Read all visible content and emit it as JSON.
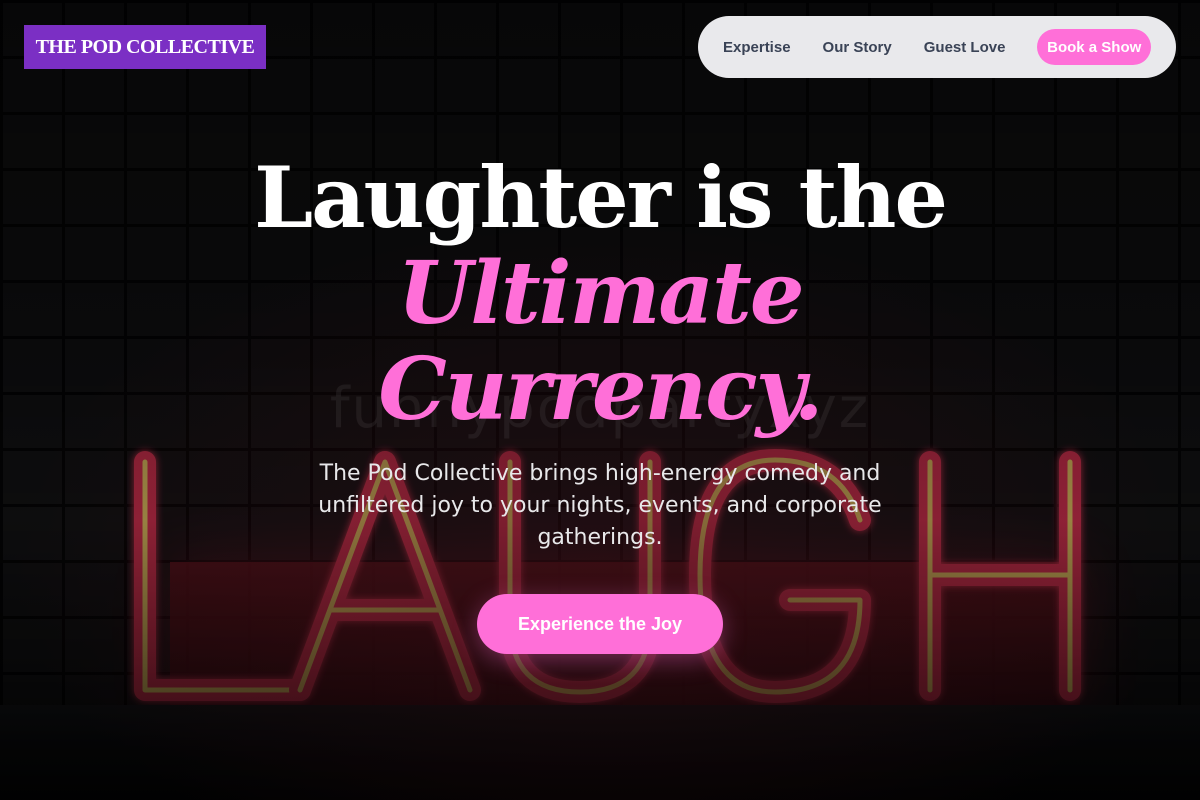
{
  "brand": {
    "name": "THE POD COLLECTIVE",
    "color": "#7b2fc4"
  },
  "nav": {
    "items": [
      {
        "label": "Expertise"
      },
      {
        "label": "Our Story"
      },
      {
        "label": "Guest Love"
      }
    ],
    "cta_label": "Book a Show"
  },
  "hero": {
    "title_line1": "Laughter is the",
    "title_line2": "Ultimate",
    "title_line3": "Currency.",
    "subtitle": "The Pod Collective brings high-energy comedy and unfiltered joy to your nights, events, and corporate gatherings.",
    "cta_label": "Experience the Joy",
    "background_watermark": "funnypodpartyxyz",
    "neon_sign_text": "LAUGH"
  },
  "colors": {
    "accent": "#ff6fd8",
    "brand_purple": "#7b2fc4",
    "nav_bg": "#e9e9ec",
    "nav_text": "#3a4356"
  }
}
